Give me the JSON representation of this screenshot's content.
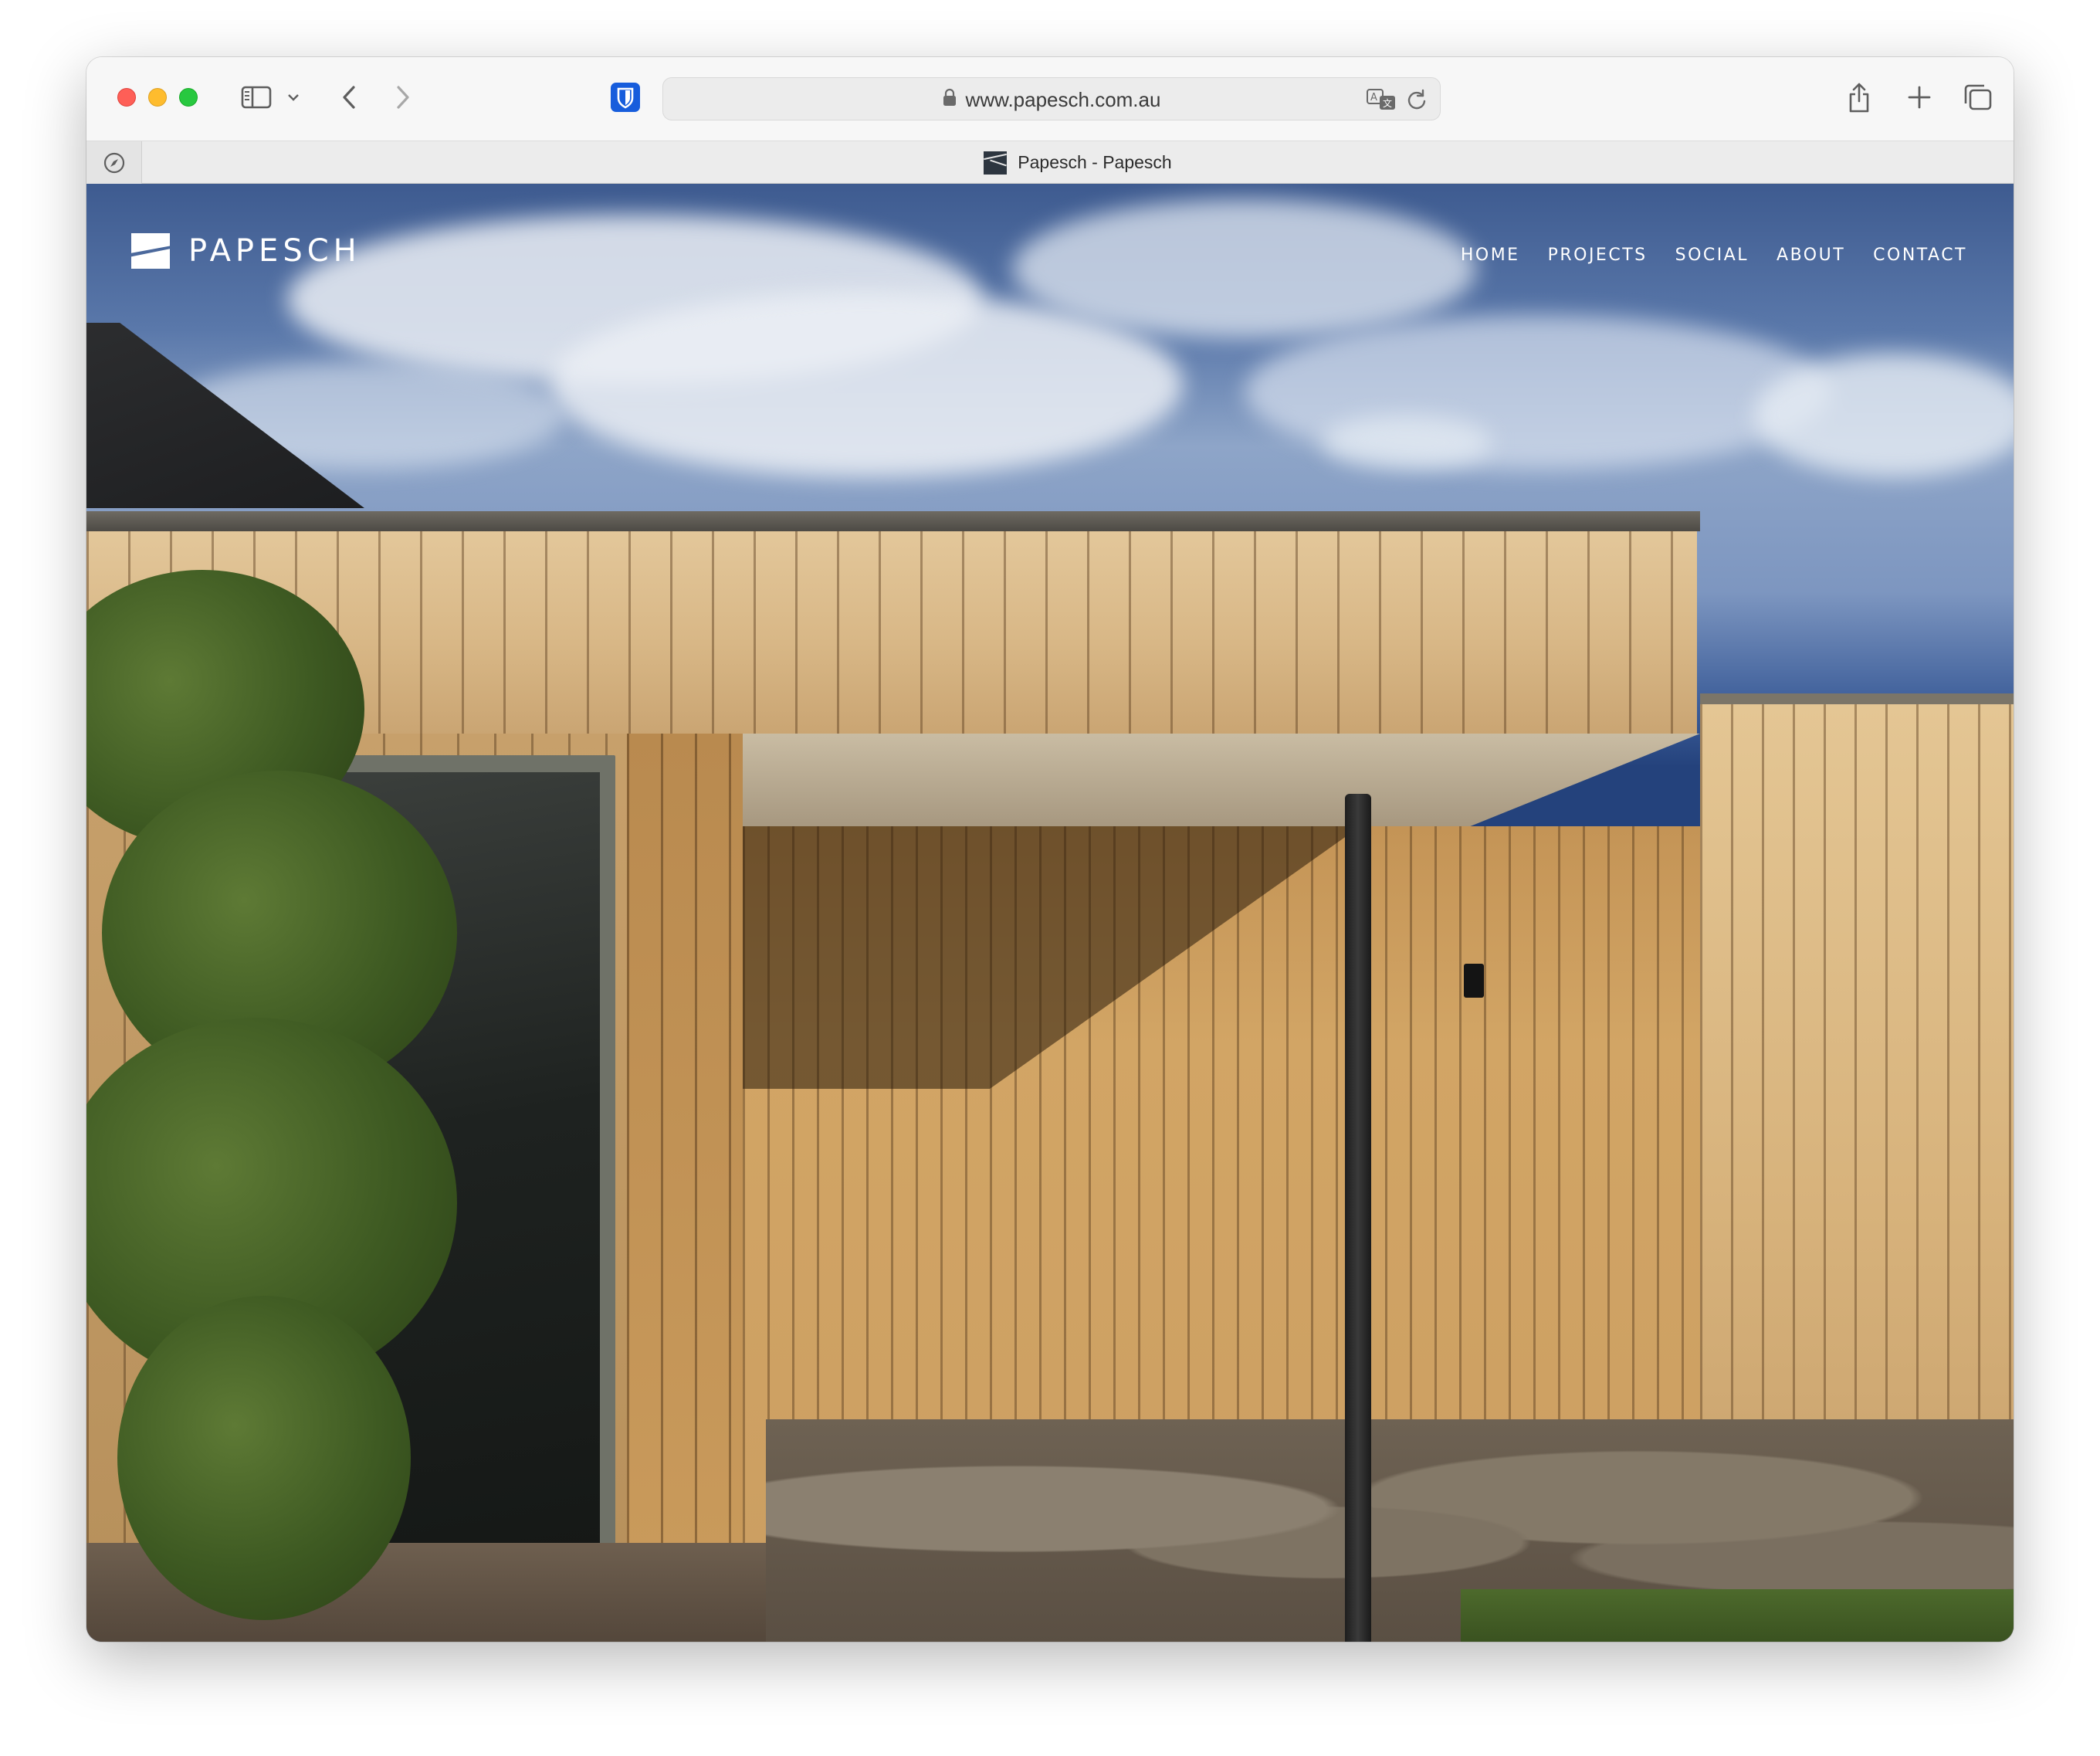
{
  "browser": {
    "url": "www.papesch.com.au",
    "tab_title": "Papesch - Papesch"
  },
  "site": {
    "logo_text": "PAPESCH",
    "nav": [
      {
        "label": "HOME"
      },
      {
        "label": "PROJECTS"
      },
      {
        "label": "SOCIAL"
      },
      {
        "label": "ABOUT"
      },
      {
        "label": "CONTACT"
      }
    ]
  },
  "icons": {
    "sidebar": "sidebar-icon",
    "back": "chevron-left-icon",
    "forward": "chevron-right-icon",
    "password_manager": "bitwarden-shield-icon",
    "lock": "lock-icon",
    "translate": "translate-icon",
    "reload": "reload-icon",
    "share": "share-icon",
    "new_tab": "plus-icon",
    "tab_overview": "tabs-icon",
    "compass": "compass-icon"
  },
  "colors": {
    "traffic_red": "#fe5f57",
    "traffic_yellow": "#febc2e",
    "traffic_green": "#28c840",
    "password_manager": "#175ddc"
  }
}
